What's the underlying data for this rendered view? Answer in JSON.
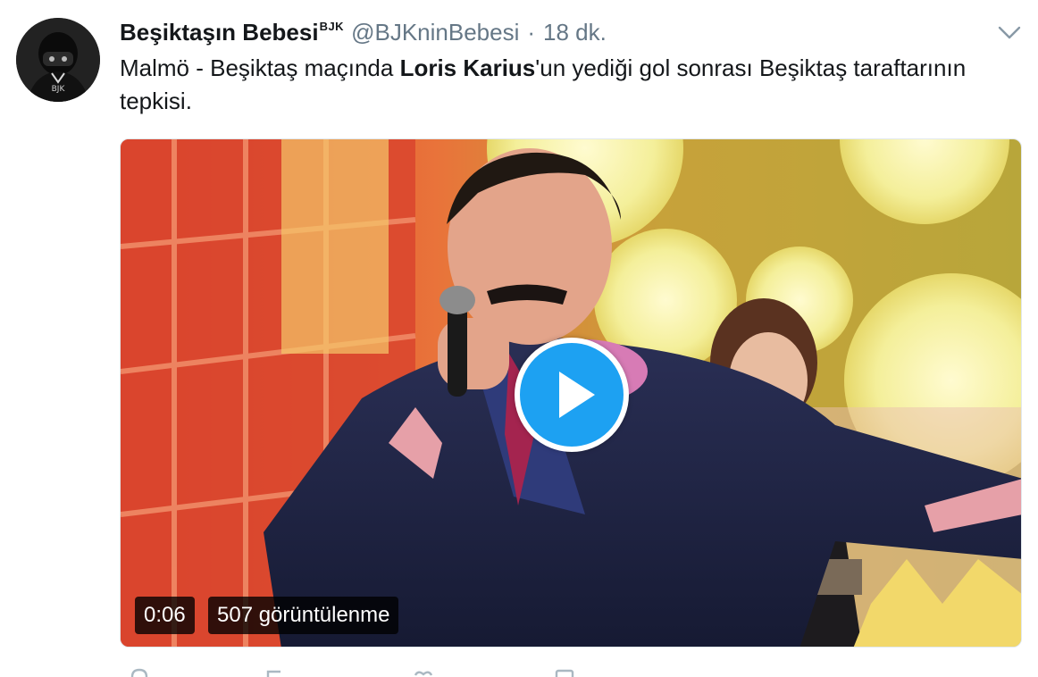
{
  "tweet": {
    "author": {
      "display_name": "Beşiktaşın Bebesi",
      "badge": "BJK",
      "handle": "@BJKninBebesi",
      "separator": "·",
      "time": "18 dk.",
      "avatar_icon": "masked-fan-avatar"
    },
    "menu_icon": "chevron-down-icon",
    "text": {
      "before": "Malmö - Beşiktaş maçında ",
      "bold": "Loris Karius",
      "after": "'un yediği gol sonrası Beşiktaş taraftarının tepkisi."
    },
    "video": {
      "duration": "0:06",
      "views": "507 görüntülenme",
      "play_icon": "play-icon",
      "play_color": "#1da1f2"
    },
    "actions": [
      "reply-icon",
      "retweet-icon",
      "like-icon",
      "message-icon"
    ]
  },
  "colors": {
    "text": "#14171a",
    "secondary": "#657786",
    "accent": "#1da1f2"
  }
}
